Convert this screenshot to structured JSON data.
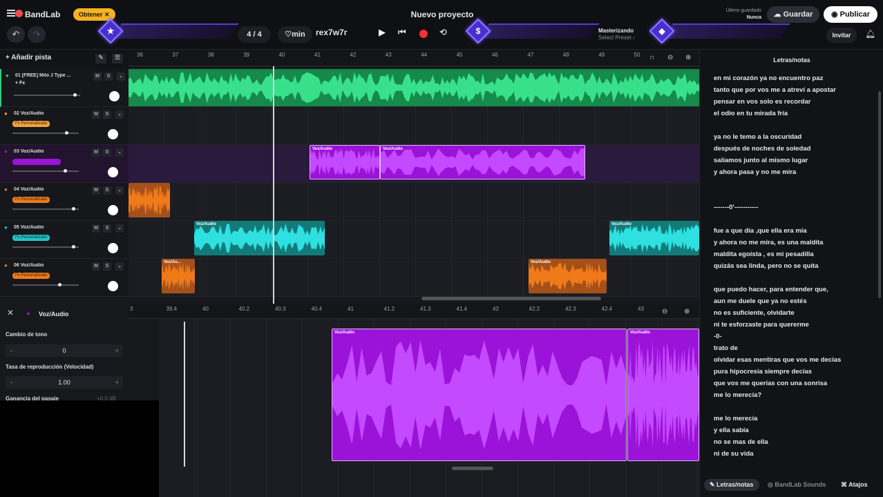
{
  "app": {
    "name": "BandLab",
    "obtener_label": "Obtener ✕",
    "project_title": "Nuevo proyecto"
  },
  "save_status": {
    "label": "Último guardado",
    "value": "Nunca"
  },
  "buttons": {
    "save": "Guardar",
    "publish": "Publicar",
    "invite": "Invitar",
    "add_track": "Añadir pista"
  },
  "time_signature": "4 / 4",
  "tempo_label": "min",
  "key_text": "rex7w7r",
  "mastering": {
    "label": "Masterizando",
    "preset": "Select Preset ›"
  },
  "ruler_ticks": [
    "36",
    "37",
    "38",
    "39",
    "40",
    "41",
    "42",
    "43",
    "44",
    "45",
    "46",
    "47",
    "48",
    "49",
    "50"
  ],
  "tracks": [
    {
      "name": "01  [FREE] Milo J Type ...",
      "sub": "+ Fx",
      "fx": "",
      "color": "#2fd07a"
    },
    {
      "name": "02  Voz/Audio",
      "fx": "Fx Personalizado",
      "color": "#f2a33a"
    },
    {
      "name": "03  Voz/Audio",
      "fx": "",
      "color": "#9b12d8"
    },
    {
      "name": "04  Voz/Audio",
      "fx": "Fx Personalizado",
      "color": "#f07a1a"
    },
    {
      "name": "05  Voz/Audio",
      "fx": "Fx Personalizado",
      "color": "#1fc4c4"
    },
    {
      "name": "06  Voz/Audio",
      "fx": "Fx Personalizado",
      "color": "#f07a1a"
    }
  ],
  "track_buttons": {
    "mute": "M",
    "solo": "S"
  },
  "clip_labels": {
    "voz": "Voz/Audio",
    "voz_short": "Voz/Au..."
  },
  "editor": {
    "title": "Voz/Audio",
    "pitch_label": "Cambio de tono",
    "pitch_value": "0",
    "rate_label": "Tasa de reproducción (Velocidad)",
    "rate_value": "1.00",
    "gain_label": "Ganancia del pasaje",
    "gain_value": "+0.0 dB",
    "ruler_ticks": [
      "3",
      "39.4",
      "40",
      "40.2",
      "40.3",
      "40.4",
      "41",
      "41.2",
      "41.3",
      "41.4",
      "42",
      "42.2",
      "42.3",
      "42.4",
      "43"
    ]
  },
  "lyrics": {
    "title": "Letras/notas",
    "lines": [
      "en mi corazón ya no encuentro paz",
      "tanto que por vos me a  atreví a apostar",
      "pensar en vos solo es recordar",
      "el odio en tu mirada fría",
      "",
      "ya no le temo a la oscuridad",
      "después de noches de soledad",
      "salíamos junto  al  mismo lugar",
      "y ahora pasa y no me mira",
      "",
      "",
      "-------0'-----------",
      "",
      "fue a que día ,que ella era mía",
      "y ahora no me mira, es una maldita",
      "maldita egoísta , es mi pesadilla",
      "quizás sea linda, pero no se quita",
      "",
      "que puedo hacer, para entender que,",
      "aun me duele que ya no estés",
      "no es suficiente, olvidarte",
      "ni te esforzaste para quererme",
      "-0-",
      "trato de",
      "olvidar esas mentiras que vos me decías",
      "pura hipocresía siempre decías",
      "que vos me querías con una sonrisa",
      "me lo merecía?",
      "",
      "me lo merecía",
      "y ella sabía",
      "no se mas de ella",
      "ni de su vida"
    ],
    "footer": {
      "lyrics": "Letras/notas",
      "sounds": "BandLab Sounds",
      "shortcuts": "Atajos"
    }
  }
}
